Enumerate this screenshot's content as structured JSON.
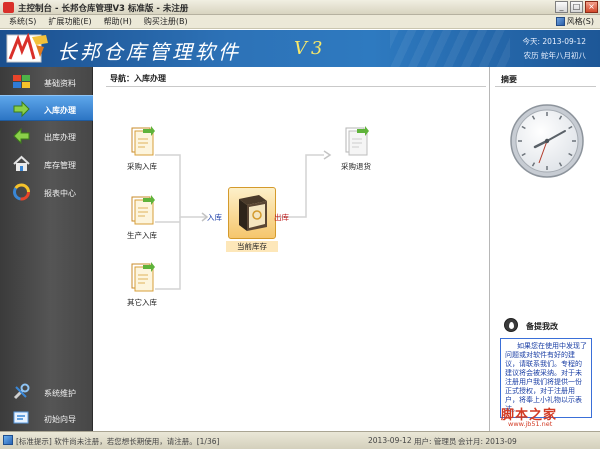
{
  "window": {
    "title": "主控制台 - 长邦仓库管理V3 标准版 - 未注册",
    "controls": {
      "minimize": "_",
      "maximize": "□",
      "close": "×"
    }
  },
  "menubar": {
    "items": [
      {
        "label": "系统(S)"
      },
      {
        "label": "扩展功能(E)"
      },
      {
        "label": "帮助(H)"
      },
      {
        "label": "购买注册(B)"
      }
    ],
    "skin_label": "风格(S)"
  },
  "banner": {
    "brand": "长邦仓库管理软件",
    "version": "V3",
    "today": "今天: 2013-09-12",
    "lunar": "农历 蛇年八月初八"
  },
  "sidebar": {
    "items": [
      {
        "label": "基础资料",
        "icon": "windows-flag-icon"
      },
      {
        "label": "入库办理",
        "icon": "arrow-right-icon",
        "active": true
      },
      {
        "label": "出库办理",
        "icon": "arrow-left-icon"
      },
      {
        "label": "库存管理",
        "icon": "house-icon"
      },
      {
        "label": "报表中心",
        "icon": "chart-ring-icon"
      }
    ],
    "bottom_items": [
      {
        "label": "系统维护",
        "icon": "tools-icon"
      },
      {
        "label": "初始向导",
        "icon": "guide-icon"
      }
    ]
  },
  "content": {
    "breadcrumb": "导航：入库办理",
    "flow": {
      "sources": [
        {
          "label": "采购入库"
        },
        {
          "label": "生产入库"
        },
        {
          "label": "其它入库"
        }
      ],
      "center": {
        "label": "当前库存"
      },
      "target": {
        "label": "采购退货"
      },
      "in_label": "入库",
      "out_label": "出库"
    }
  },
  "summary": {
    "header": "摘要",
    "memo_title": "备提我改",
    "memo_text": "如果您在使用中发现了问题或对软件有好的建议，请联系我们。专程的建议将会被采纳。对于未注册用户我们将提供一份正式授权，对于注册用户，将奉上小礼物以示表达。"
  },
  "watermark": {
    "main": "脚本之家",
    "url": "www.jb51.net"
  },
  "statusbar": {
    "hint": "[标准提示] 软件尚未注册，若您想长期使用，请注册。[1/36]",
    "date": "2013-09-12",
    "user": "用户: 管理员",
    "period": "会计月: 2013-09"
  },
  "colors": {
    "banner": "#2d72b7",
    "sidebar": "#474747",
    "active": "#3d89d8",
    "version": "#f7e86a",
    "in": "#1d3fa8",
    "out": "#c01a1a"
  }
}
